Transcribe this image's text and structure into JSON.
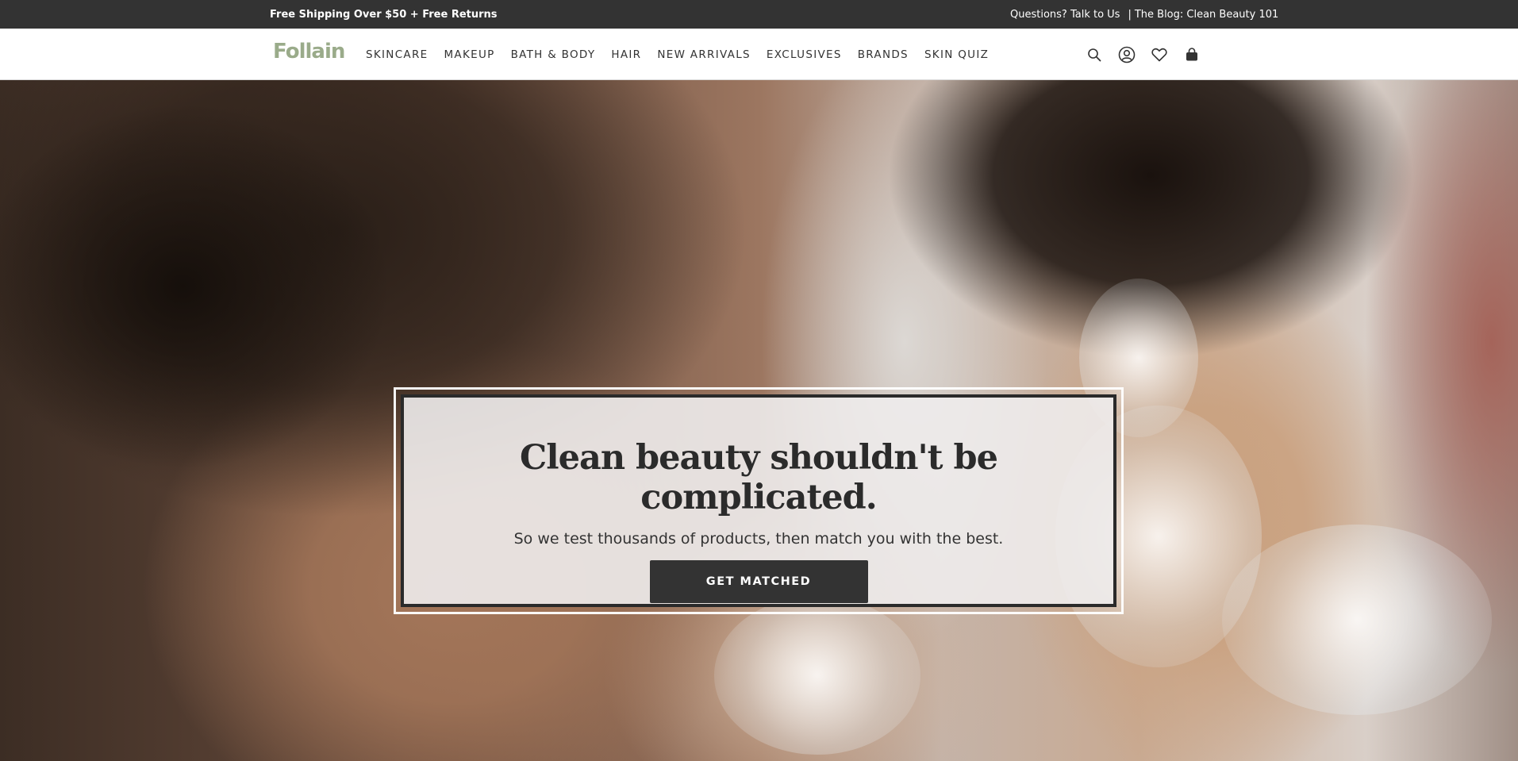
{
  "topbar": {
    "promo": "Free Shipping Over $50 + Free Returns",
    "contact_link": "Questions? Talk to Us",
    "separator": "|",
    "blog_link": "The Blog: Clean Beauty 101",
    "background": "#333333"
  },
  "nav": {
    "logo": "Follain",
    "logo_color": "#9aab8a",
    "items": [
      {
        "label": "SKINCARE"
      },
      {
        "label": "MAKEUP"
      },
      {
        "label": "BATH & BODY"
      },
      {
        "label": "HAIR"
      },
      {
        "label": "NEW ARRIVALS"
      },
      {
        "label": "EXCLUSIVES"
      },
      {
        "label": "BRANDS"
      },
      {
        "label": "SKIN QUIZ"
      }
    ],
    "icons": [
      "search-icon",
      "account-icon",
      "heart-icon",
      "bag-icon"
    ]
  },
  "hero": {
    "headline": "Clean beauty shouldn't be complicated.",
    "subheadline": "So we test thousands of products, then match you with the best.",
    "cta_label": "GET MATCHED",
    "cta_color": "#333333"
  }
}
